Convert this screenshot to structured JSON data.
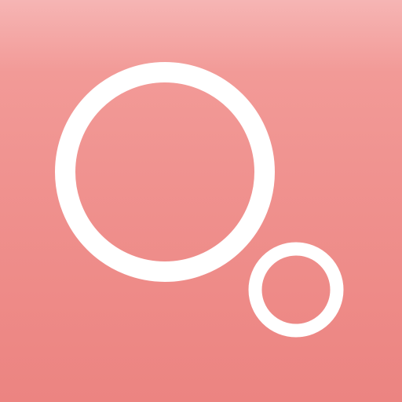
{
  "app_icon": {
    "icon": "two-rings-logo-icon",
    "colors": {
      "background_top": "#f6b5b4",
      "background_bottom": "#ec8481",
      "ring": "#ffffff"
    }
  }
}
